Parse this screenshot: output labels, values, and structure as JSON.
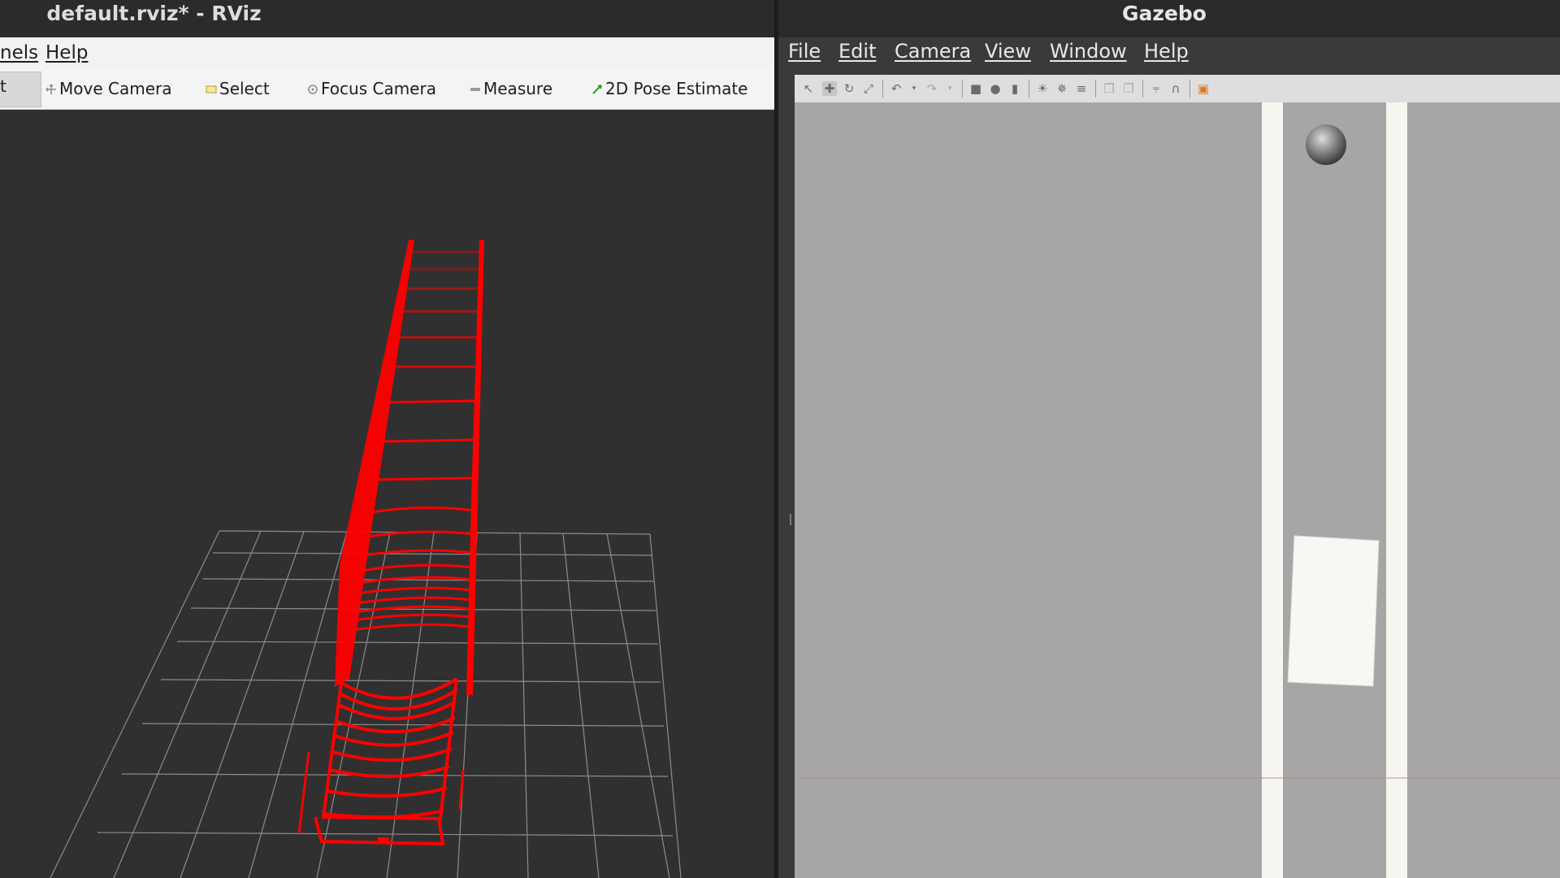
{
  "rviz": {
    "title": "default.rviz* - RViz",
    "menus": [
      "nels",
      "Help"
    ],
    "toolbar": {
      "interact_label": "t",
      "tools": [
        "Move Camera",
        "Select",
        "Focus Camera",
        "Measure",
        "2D Pose Estimate"
      ]
    },
    "colors": {
      "laser_scan": "#ff0000",
      "grid": "#9a9a9a",
      "background": "#303030"
    }
  },
  "gazebo": {
    "title": "Gazebo",
    "menus": [
      "File",
      "Edit",
      "Camera",
      "View",
      "Window",
      "Help"
    ],
    "toolbar_icons": [
      "select-arrow",
      "translate",
      "rotate",
      "scale",
      "undo",
      "undo-dropdown",
      "redo",
      "redo-dropdown",
      "box",
      "sphere",
      "cylinder",
      "point-light",
      "spot-light",
      "directional-light",
      "copy",
      "paste",
      "align",
      "snap",
      "screenshot"
    ],
    "colors": {
      "ground": "#a6a6a6",
      "wall": "#f5f5f0"
    }
  }
}
